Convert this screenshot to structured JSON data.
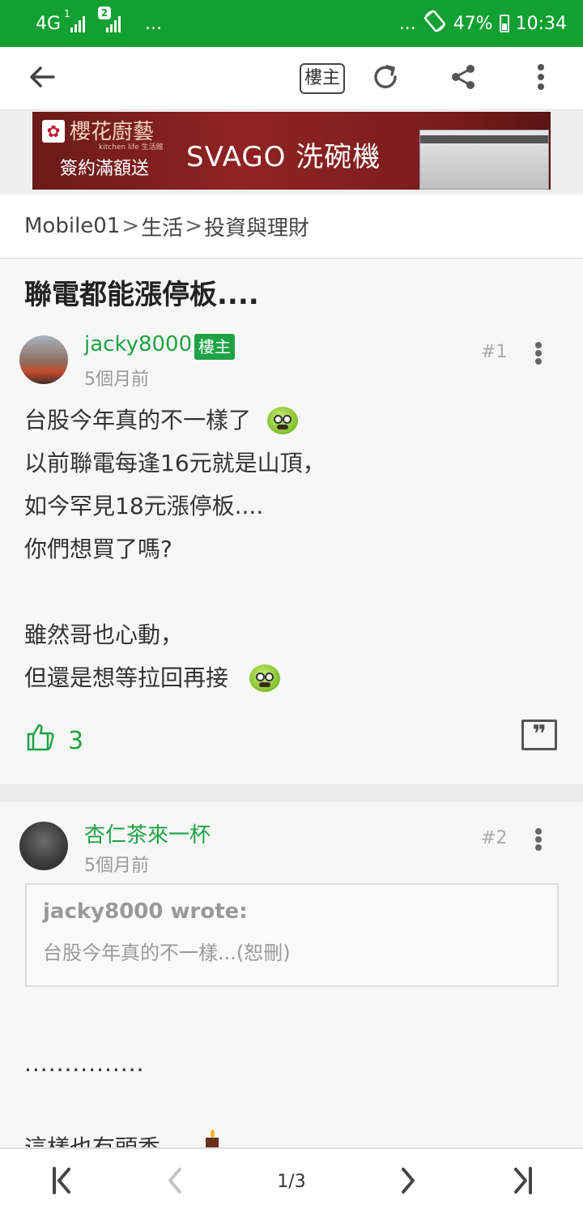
{
  "status_bar": {
    "network": "4G",
    "sim1": "1",
    "sim2": "2",
    "more_left": "...",
    "more_right": "...",
    "battery": "47%",
    "time": "10:34"
  },
  "toolbar": {
    "op_filter_label": "樓主",
    "back_icon": "arrow-left-icon",
    "refresh_icon": "refresh-icon",
    "share_icon": "share-icon",
    "menu_icon": "more-vertical-icon"
  },
  "ad": {
    "brand": "櫻花廚藝",
    "brand_sub": "kitchen life 生活館",
    "promo": "簽約滿額送",
    "product": "SVAGO 洗碗機"
  },
  "breadcrumb": [
    "Mobile01",
    "生活",
    "投資與理財"
  ],
  "breadcrumb_sep": ">",
  "thread": {
    "title": "聯電都能漲停板...."
  },
  "posts": [
    {
      "username": "jacky8000",
      "badge": "樓主",
      "time": "5個月前",
      "floor": "#1",
      "lines": [
        "台股今年真的不一樣了",
        "以前聯電每逢16元就是山頂，",
        "如今罕見18元漲停板....",
        "你們想買了嗎?",
        "",
        "雖然哥也心動，",
        "但還是想等拉回再接"
      ],
      "likes": "3"
    },
    {
      "username": "杏仁茶來一杯",
      "time": "5個月前",
      "floor": "#2",
      "quote_author": "jacky8000 wrote:",
      "quote_text": "台股今年真的不一樣...(恕刪)",
      "dots": "...............",
      "partial_line": "這樣也有頭香"
    }
  ],
  "pagination": {
    "page": "1/3"
  },
  "colors": {
    "accent": "#1ea244",
    "statusbar": "#12a033"
  }
}
